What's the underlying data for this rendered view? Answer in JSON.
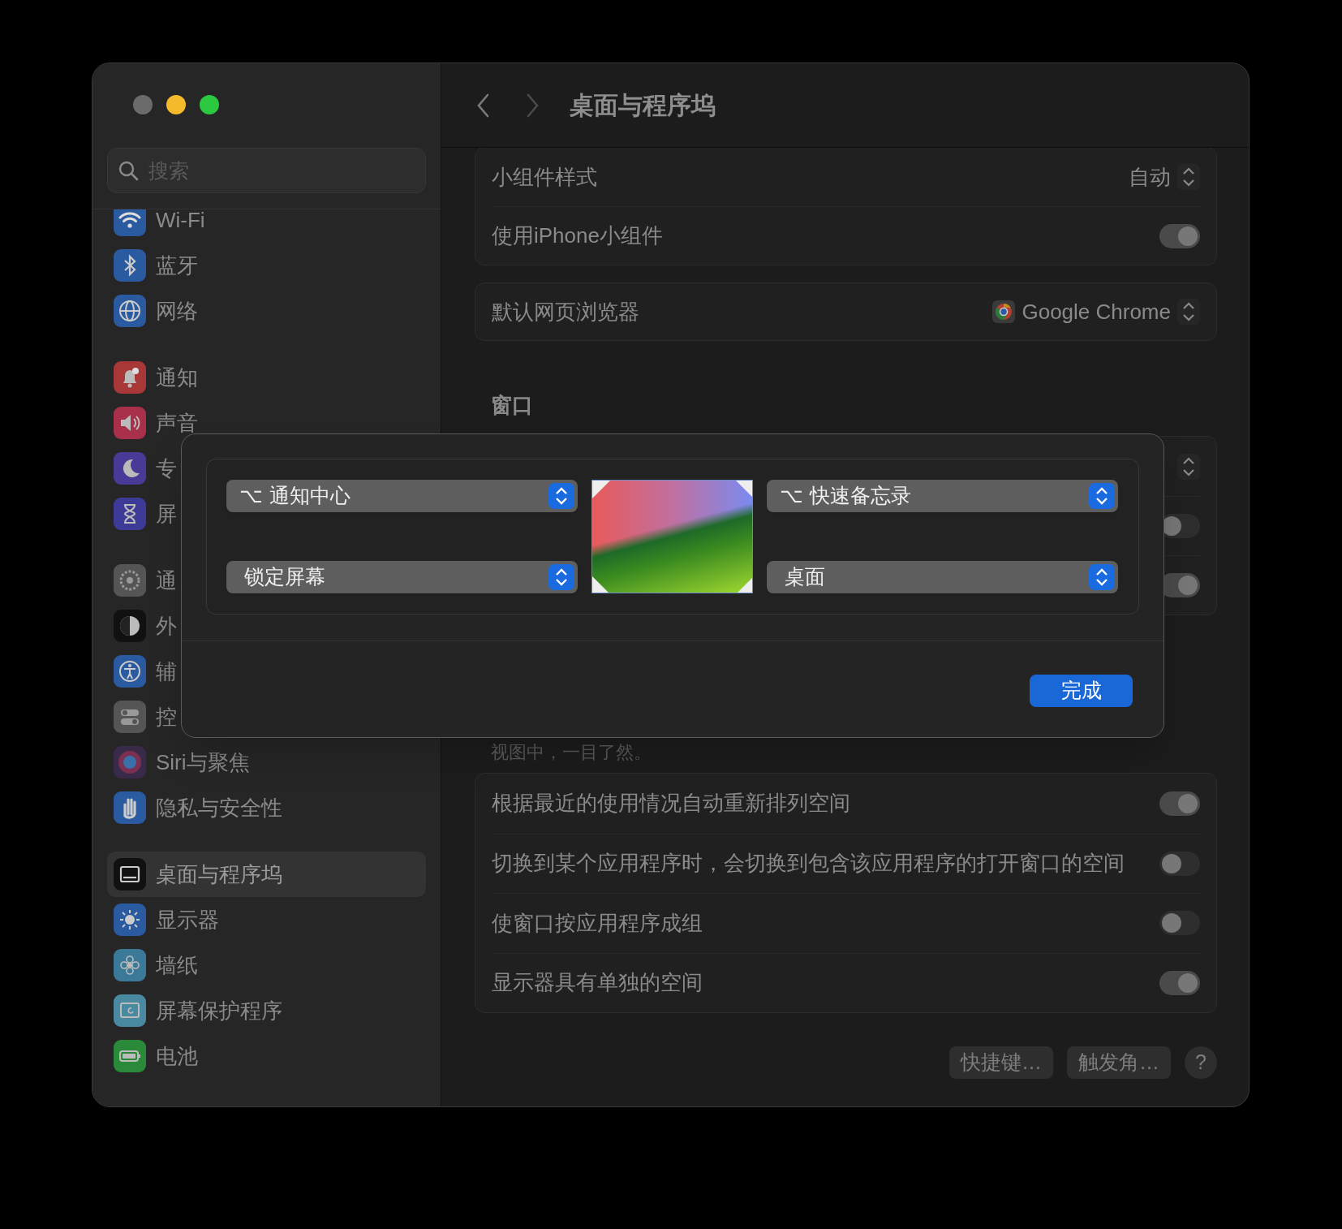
{
  "window": {
    "title": "桌面与程序坞"
  },
  "sidebar": {
    "search": {
      "placeholder": "搜索"
    },
    "sections": [
      {
        "items": [
          {
            "label": "Wi-Fi",
            "selected": false
          },
          {
            "label": "蓝牙",
            "selected": false
          },
          {
            "label": "网络",
            "selected": false
          }
        ]
      },
      {
        "items": [
          {
            "label": "通知",
            "selected": false
          },
          {
            "label": "声音",
            "selected": false
          },
          {
            "label": "专",
            "selected": false
          },
          {
            "label": "屏",
            "selected": false
          }
        ]
      },
      {
        "items": [
          {
            "label": "通",
            "selected": false
          },
          {
            "label": "外",
            "selected": false
          },
          {
            "label": "辅",
            "selected": false
          },
          {
            "label": "控",
            "selected": false
          },
          {
            "label": "Siri与聚焦",
            "selected": false
          },
          {
            "label": "隐私与安全性",
            "selected": false
          }
        ]
      },
      {
        "items": [
          {
            "label": "桌面与程序坞",
            "selected": true
          },
          {
            "label": "显示器",
            "selected": false
          },
          {
            "label": "墙纸",
            "selected": false
          },
          {
            "label": "屏幕保护程序",
            "selected": false
          },
          {
            "label": "电池",
            "selected": false
          }
        ]
      }
    ]
  },
  "groups": [
    {
      "rows": [
        {
          "kind": "popup",
          "label": "小组件样式",
          "value": "自动"
        },
        {
          "kind": "toggle",
          "label": "使用iPhone小组件",
          "on": true
        }
      ]
    },
    {
      "rows": [
        {
          "kind": "app_popup",
          "label": "默认网页浏览器",
          "value": "Google Chrome"
        }
      ]
    },
    {
      "heading": "窗口",
      "rows": [
        {
          "kind": "popup"
        },
        {
          "kind": "toggle",
          "on": false
        },
        {
          "kind": "toggle",
          "on": true
        }
      ]
    },
    {
      "description": "视图中，一目了然。",
      "rows": [
        {
          "kind": "toggle",
          "label": "根据最近的使用情况自动重新排列空间",
          "on": true
        },
        {
          "kind": "toggle",
          "label": "切换到某个应用程序时，会切换到包含该应用程序的打开窗口的空间",
          "on": false
        },
        {
          "kind": "toggle",
          "label": "使窗口按应用程序成组",
          "on": false
        },
        {
          "kind": "toggle",
          "label": "显示器具有单独的空间",
          "on": true
        }
      ]
    }
  ],
  "footer": {
    "buttons": [
      "快捷键…",
      "触发角…"
    ],
    "help": "?"
  },
  "hot_corners_dialog": {
    "corners": [
      {
        "modifier": "⌥",
        "action": "通知中心"
      },
      {
        "modifier": "⌥",
        "action": "快速备忘录"
      },
      {
        "action": "锁定屏幕"
      },
      {
        "action": "桌面"
      }
    ],
    "done_button": "完成"
  }
}
